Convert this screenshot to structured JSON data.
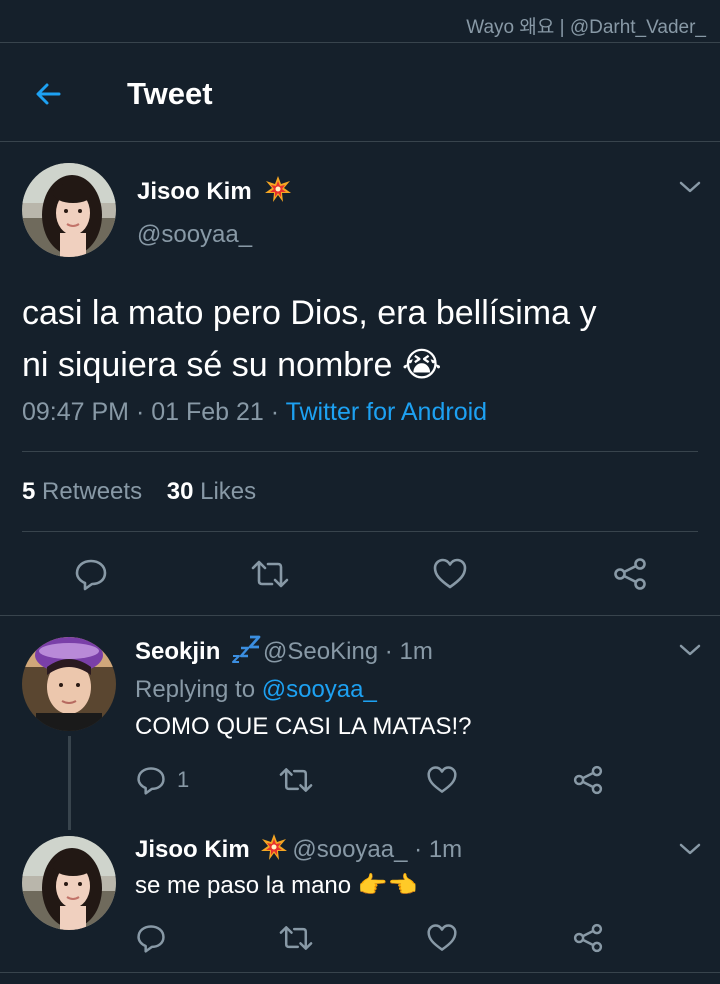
{
  "watermark": "Wayo 왜요 | @Darht_Vader_",
  "header": {
    "title": "Tweet"
  },
  "tweet": {
    "author_name": "Jisoo Kim",
    "author_handle": "@sooyaa_",
    "text_line1": "casi la mato pero Dios, era bellísima y",
    "text_line2": "ni siquiera sé su nombre",
    "text_emoji": "😭",
    "timestamp": "09:47 PM · 01 Feb 21 · ",
    "source": "Twitter for Android",
    "retweet_count": "5",
    "retweet_label": " Retweets",
    "like_count": "30",
    "like_label": " Likes"
  },
  "replies": [
    {
      "author_name": "Seokjin",
      "author_handle": "@SeoKing",
      "time": " · 1m",
      "replying_prefix": "Replying to ",
      "replying_handle": "@sooyaa_",
      "text": "COMO QUE CASI LA MATAS!?",
      "reply_count": "1"
    },
    {
      "author_name": "Jisoo Kim",
      "author_handle": "@sooyaa_",
      "time": " · 1m",
      "text": "se me paso la mano",
      "emoji": "👉👈"
    }
  ],
  "colors": {
    "background": "#15202b",
    "accent": "#1da1f2",
    "muted": "#8899a6",
    "divider": "#38444d"
  }
}
